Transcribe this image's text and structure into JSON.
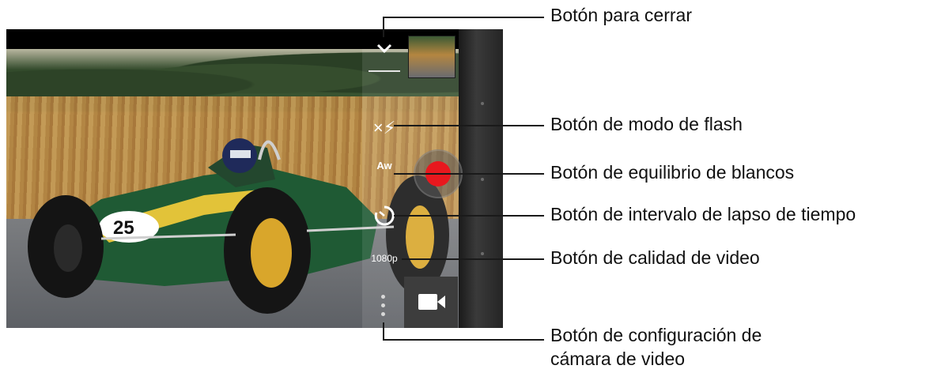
{
  "screen": {
    "close_icon": "chevron-down-icon",
    "flash_icon": "flash-off-icon",
    "flash_glyph": "×⚡",
    "white_balance_glyph": "Aw",
    "timer_icon": "timer-icon",
    "video_quality": "1080p",
    "settings_icon": "more-vertical-icon",
    "record_color": "#e8181e",
    "camera_mode_icon": "video-camera-icon"
  },
  "callouts": [
    "Botón para cerrar",
    "Botón de modo de flash",
    "Botón de equilibrio de blancos",
    "Botón de intervalo de lapso de tiempo",
    "Botón de calidad de video",
    "Botón de configuración de",
    "cámara de video"
  ]
}
